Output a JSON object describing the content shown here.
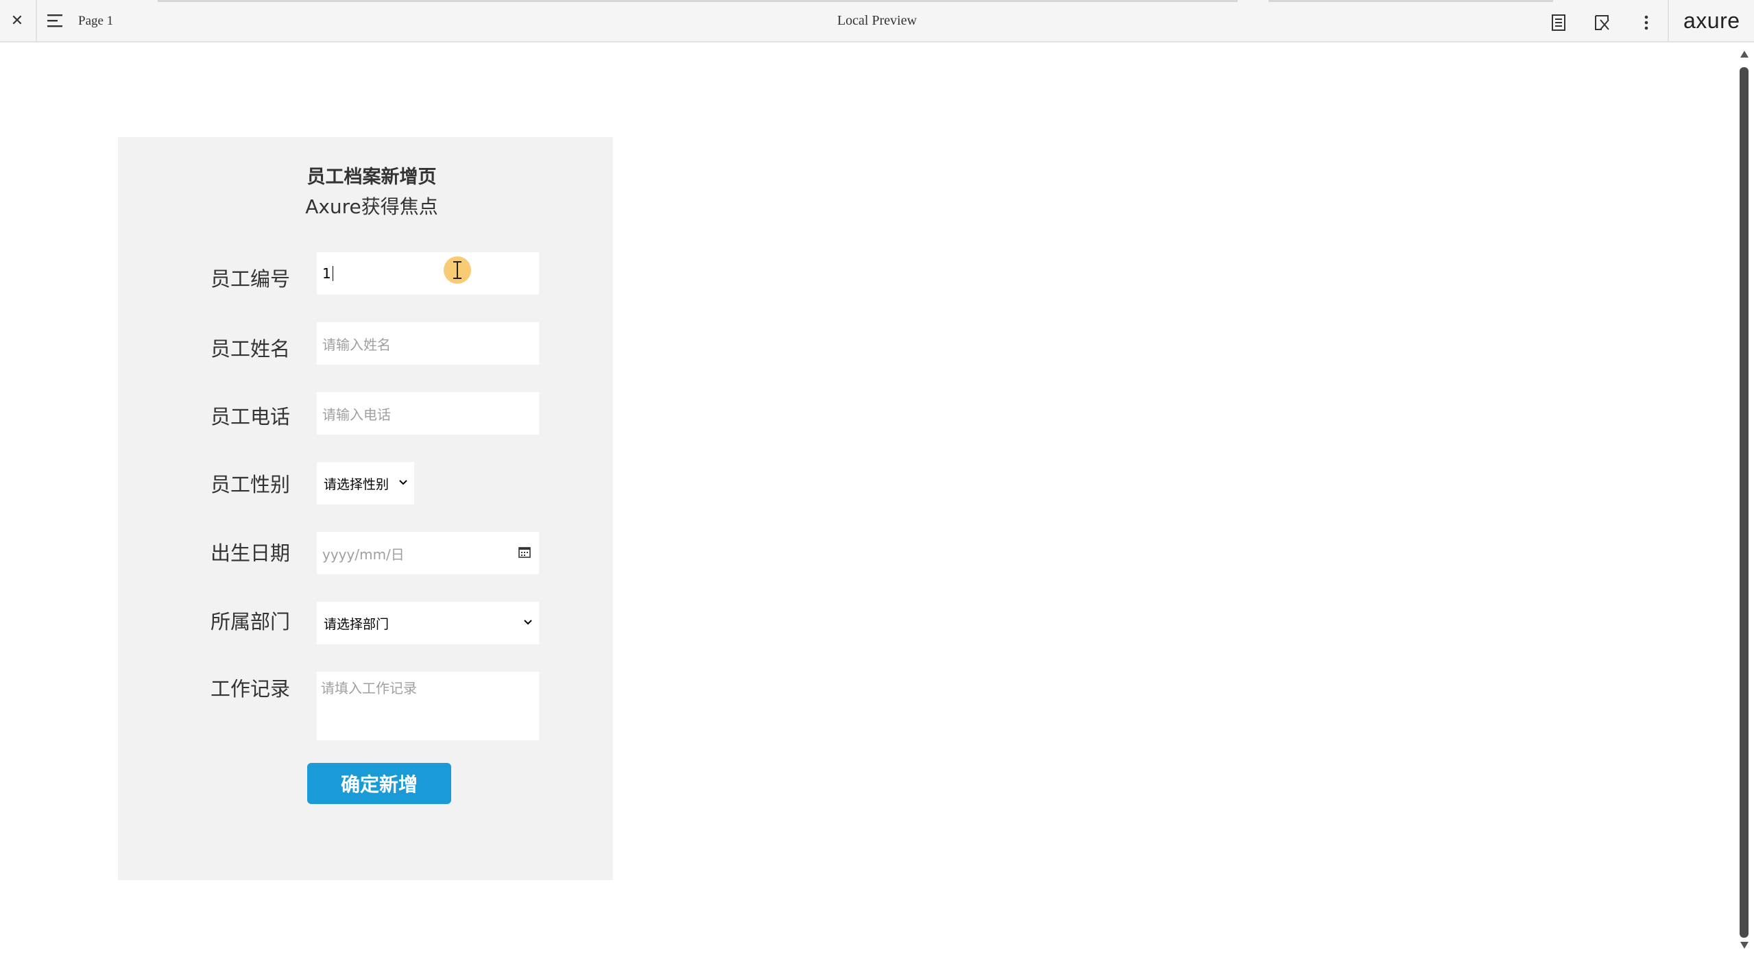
{
  "toolbar": {
    "close_symbol": "✕",
    "page_label": "Page 1",
    "title": "Local Preview",
    "logo": "axure"
  },
  "form": {
    "title": "员工档案新增页",
    "subtitle": "Axure获得焦点",
    "fields": {
      "employee_id": {
        "label": "员工编号",
        "value": "1"
      },
      "employee_name": {
        "label": "员工姓名",
        "placeholder": "请输入姓名"
      },
      "employee_phone": {
        "label": "员工电话",
        "placeholder": "请输入电话"
      },
      "employee_gender": {
        "label": "员工性别",
        "selected": "请选择性别"
      },
      "birth_date": {
        "label": "出生日期",
        "placeholder": "yyyy/mm/日"
      },
      "department": {
        "label": "所属部门",
        "selected": "请选择部门"
      },
      "work_record": {
        "label": "工作记录",
        "placeholder": "请填入工作记录"
      }
    },
    "submit_label": "确定新增"
  },
  "colors": {
    "accent": "#1a9bd8",
    "panel_bg": "#f2f2f2",
    "cursor_highlight": "#f5b946"
  }
}
